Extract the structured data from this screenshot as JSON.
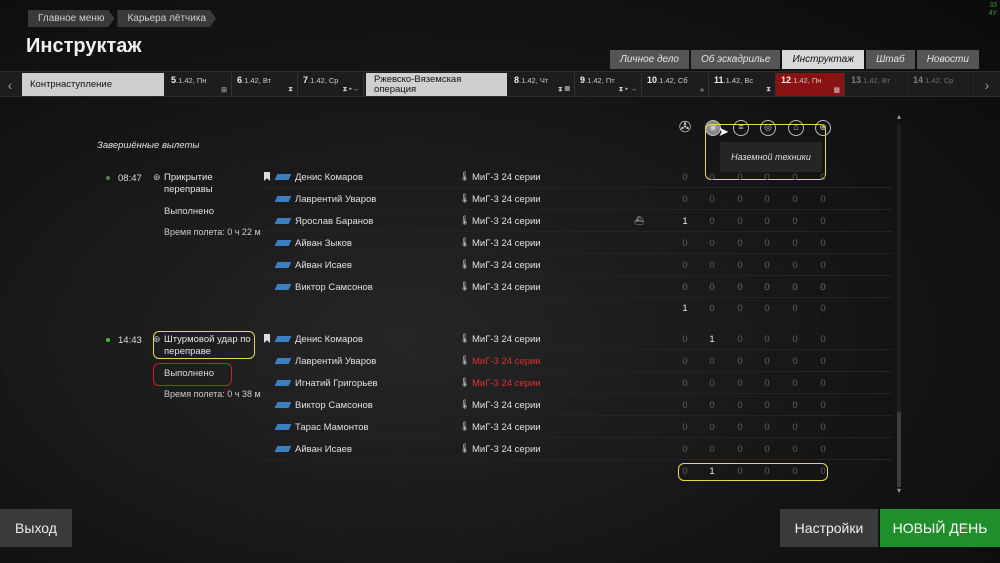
{
  "breadcrumbs": [
    "Главное меню",
    "Карьера лётчика"
  ],
  "page_title": "Инструктаж",
  "corner_text": [
    "33",
    "4У"
  ],
  "tabs": [
    {
      "label": "Личное дело",
      "active": false
    },
    {
      "label": "Об эскадрилье",
      "active": false
    },
    {
      "label": "Инструктаж",
      "active": true
    },
    {
      "label": "Штаб",
      "active": false
    },
    {
      "label": "Новости",
      "active": false
    }
  ],
  "timeline": {
    "op1": "Контрнаступление",
    "op2": "Ржевско-Вяземская операция",
    "days": [
      {
        "num": "5",
        "date": ".1.42, Пн",
        "icon": "⊞"
      },
      {
        "num": "6",
        "date": ".1.42, Вт",
        "icon": "⧗"
      },
      {
        "num": "7",
        "date": ".1.42, Ср",
        "icon": "⧗ ▸→"
      },
      {
        "num": "8",
        "date": ".1.42, Чт",
        "icon": "⧗ ▦"
      },
      {
        "num": "9",
        "date": ".1.42, Пт",
        "icon": "⧗ ▸ →"
      },
      {
        "num": "10",
        "date": ".1.42, Сб",
        "icon": "»"
      },
      {
        "num": "11",
        "date": ".1.42, Вс",
        "icon": "⧗"
      },
      {
        "num": "12",
        "date": ".1.42, Пн",
        "icon": "▦"
      },
      {
        "num": "13",
        "date": ".1.42, Вт",
        "icon": ""
      },
      {
        "num": "14",
        "date": ".1.42, Ср",
        "icon": ""
      }
    ]
  },
  "section_title": "Завершённые вылеты",
  "tooltip": "Наземной техники",
  "missions": [
    {
      "time": "08:47",
      "name": "Прикрытие переправы",
      "status": "Выполнено",
      "flight_time": "Время полета: 0 ч 22 м",
      "pilots": [
        {
          "name": "Денис Комаров",
          "plane": "МиГ-3 24 серии",
          "red": false,
          "lead": true,
          "vals": [
            "0",
            "0",
            "0",
            "0",
            "0",
            "0"
          ]
        },
        {
          "name": "Лаврентий Уваров",
          "plane": "МиГ-3 24 серии",
          "red": false,
          "lead": false,
          "vals": [
            "0",
            "0",
            "0",
            "0",
            "0",
            "0"
          ]
        },
        {
          "name": "Ярослав Баранов",
          "plane": "МиГ-3 24 серии",
          "red": false,
          "lead": false,
          "ship": true,
          "vals": [
            "1",
            "0",
            "0",
            "0",
            "0",
            "0"
          ]
        },
        {
          "name": "Айван Зыков",
          "plane": "МиГ-3 24 серии",
          "red": false,
          "lead": false,
          "vals": [
            "0",
            "0",
            "0",
            "0",
            "0",
            "0"
          ]
        },
        {
          "name": "Айван Исаев",
          "plane": "МиГ-3 24 серии",
          "red": false,
          "lead": false,
          "vals": [
            "0",
            "0",
            "0",
            "0",
            "0",
            "0"
          ]
        },
        {
          "name": "Виктор Самсонов",
          "plane": "МиГ-3 24 серии",
          "red": false,
          "lead": false,
          "vals": [
            "0",
            "0",
            "0",
            "0",
            "0",
            "0"
          ]
        }
      ],
      "totals_a": [
        "0",
        "0",
        "0",
        "0",
        "0",
        "0"
      ],
      "totals_b": [
        "1",
        "0",
        "0",
        "0",
        "0",
        "0"
      ]
    },
    {
      "time": "14:43",
      "name": "Штурмовой удар по переправе",
      "status": "Выполнено",
      "flight_time": "Время полета: 0 ч 38 м",
      "pilots": [
        {
          "name": "Денис Комаров",
          "plane": "МиГ-3 24 серии",
          "red": false,
          "lead": true,
          "vals": [
            "0",
            "1",
            "0",
            "0",
            "0",
            "0"
          ]
        },
        {
          "name": "Лаврентий Уваров",
          "plane": "МиГ-3 24 серии",
          "red": true,
          "lead": false,
          "vals": [
            "0",
            "0",
            "0",
            "0",
            "0",
            "0"
          ]
        },
        {
          "name": "Игнатий Григорьев",
          "plane": "МиГ-3 24 серии",
          "red": true,
          "lead": false,
          "vals": [
            "0",
            "0",
            "0",
            "0",
            "0",
            "0"
          ]
        },
        {
          "name": "Виктор Самсонов",
          "plane": "МиГ-3 24 серии",
          "red": false,
          "lead": false,
          "vals": [
            "0",
            "0",
            "0",
            "0",
            "0",
            "0"
          ]
        },
        {
          "name": "Тарас Мамонтов",
          "plane": "МиГ-3 24 серии",
          "red": false,
          "lead": false,
          "vals": [
            "0",
            "0",
            "0",
            "0",
            "0",
            "0"
          ]
        },
        {
          "name": "Айван Исаев",
          "plane": "МиГ-3 24 серии",
          "red": false,
          "lead": false,
          "vals": [
            "0",
            "0",
            "0",
            "0",
            "0",
            "0"
          ]
        }
      ],
      "totals": [
        "0",
        "1",
        "0",
        "0",
        "0",
        "0"
      ]
    }
  ],
  "buttons": {
    "exit": "Выход",
    "settings": "Настройки",
    "new_day": "НОВЫЙ ДЕНЬ"
  }
}
